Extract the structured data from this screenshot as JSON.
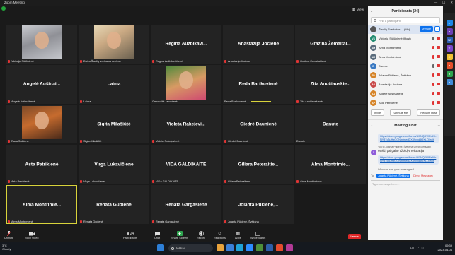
{
  "window": {
    "title": "Zoom Meeting",
    "view_label": "View"
  },
  "tiles": [
    {
      "name": "Viktorija Sičiūnienė",
      "label": "Viktorija Sičiūnienė",
      "photo": "p1",
      "muted": true
    },
    {
      "name": "Daiva Šiaulių sveikatos centras",
      "label": "Daiva Šiaulių sveikatos centras",
      "photo": "p2",
      "muted": true
    },
    {
      "name": "Regina Aužbikavi...",
      "label": "Regina Aužbikavičienė",
      "muted": true
    },
    {
      "name": "Anastazija Jociene",
      "label": "Anastazija Jociene",
      "muted": true
    },
    {
      "name": "Gražina Žemaitai...",
      "label": "Gražina Žemaitaitienė",
      "muted": true
    },
    {
      "name": "Angelė Aušinai...",
      "label": "Angelė Aušinaitienė",
      "muted": true
    },
    {
      "name": "Laima",
      "label": "Laima",
      "muted": true
    },
    {
      "name": "Genovaitė Jakonienė",
      "label": "Genovaitė Jakonienė",
      "photo": "p3",
      "muted": false
    },
    {
      "name": "Reda Bartkuvienė",
      "label": "Reda Bartkuvienė",
      "muted": false,
      "speaking": true
    },
    {
      "name": "Zita Anučiauskie...",
      "label": "Zita Anučiauskienė",
      "muted": true
    },
    {
      "name": "Rasa Sutkiene",
      "label": "Rasa Sutkiene",
      "photo": "p4",
      "muted": true
    },
    {
      "name": "Sigita Milašiūtė",
      "label": "Sigita Milašiūtė",
      "muted": true
    },
    {
      "name": "Violeta Rakejevi...",
      "label": "Violeta Rakejevienė",
      "muted": true
    },
    {
      "name": "Giedrė Daunienė",
      "label": "Giedrė Daunienė",
      "muted": true
    },
    {
      "name": "Danute",
      "label": "Danute",
      "muted": false
    },
    {
      "name": "Asta Petrikienė",
      "label": "Asta Petrikienė",
      "muted": true
    },
    {
      "name": "Virga Lukavičiene",
      "label": "Virga Lukavičiene",
      "muted": true
    },
    {
      "name": "VIDA GALDIKAITE",
      "label": "VIDA GALDIKAITE",
      "muted": true
    },
    {
      "name": "Giliara Peteraitie...",
      "label": "Giliara Peteraitienė",
      "muted": true
    },
    {
      "name": "Alma Montrimie...",
      "label": "Alma Montrimienė",
      "muted": true
    },
    {
      "name": "Alma Montrimie...",
      "label": "Alma Montrimienė",
      "muted": true,
      "active": true
    },
    {
      "name": "Renata Gudienė",
      "label": "Renata Gudienė",
      "muted": true
    },
    {
      "name": "Renata Gargasienė",
      "label": "Renata Gargasienė",
      "muted": true
    },
    {
      "name": "Jolanta Pūkienė,...",
      "label": "Jolanta Pūkienė, Švėkšna",
      "muted": true
    },
    {
      "name": "",
      "label": "",
      "empty": true
    }
  ],
  "participants": {
    "title": "Participants (24)",
    "search_placeholder": "Find a participant",
    "mute_label": "Unmute",
    "more_label": "...",
    "list": [
      {
        "initials": "",
        "name": "Šiaulių Sveikatos ... (Me)",
        "color": "#555555",
        "selected": true
      },
      {
        "initials": "VS",
        "name": "Viktorija Sičiūnienė (Host)",
        "color": "#1f8a70"
      },
      {
        "initials": "AM",
        "name": "Alma Montrimienė",
        "color": "#5a6c7d"
      },
      {
        "initials": "AM",
        "name": "Alma Montrimienė",
        "color": "#5a6c7d"
      },
      {
        "initials": "D",
        "name": "Danute",
        "color": "#3a79c2"
      },
      {
        "initials": "JP",
        "name": "Jolanta Pūkienė, Švėkšna",
        "color": "#d6852a"
      },
      {
        "initials": "AJ",
        "name": "Anastazija Jociene",
        "color": "#c94a4a"
      },
      {
        "initials": "AA",
        "name": "Angelė Aušinaitienė",
        "color": "#d6852a"
      },
      {
        "initials": "AP",
        "name": "Asta Petrikienė",
        "color": "#d6852a"
      }
    ],
    "buttons": [
      "Invite",
      "Unmute Me",
      "Reclaim Host"
    ]
  },
  "chat": {
    "title": "Meeting Chat",
    "link1": "https://docs.google.com/forms/d/1NQDWRr59hNY37c3uHxGGNmfmedDX89ypd5f9XLQ/edit",
    "meta": "You to Jolanta Pūkienė, Švėkšna(Direct Message)",
    "avatar": "S",
    "message": "sveiki, gal galite užpildyti reistracija",
    "link2": "https://docs.google.com/forms/d/1NQDWRr59hNY37c3uHxGGNmfmedDX89ypd5f9XLQ/edit",
    "who_can": "Who can see your messages?",
    "to_label": "To:",
    "to_value": "Jolanta Pūkienė, Švėkšna",
    "dm_label": "(Direct Message)",
    "input_placeholder": "Type message here..."
  },
  "toolbar": {
    "unmute": "Unmute",
    "stop_video": "Stop Video",
    "participants": "Participants",
    "participants_count": "24",
    "chat": "Chat",
    "share": "Share Screen",
    "record": "Record",
    "reactions": "Reactions",
    "apps": "Apps",
    "whiteboards": "Whiteboards",
    "leave": "Leave"
  },
  "taskbar": {
    "temp": "3°C",
    "weather": "Cloudy",
    "search": "Ieškai",
    "lang": "LIT",
    "time": "09:39",
    "date": "2023-04-04"
  },
  "colors": {
    "accent": "#0e72ed",
    "leave": "#e02828",
    "active_border": "#d8d33b"
  }
}
